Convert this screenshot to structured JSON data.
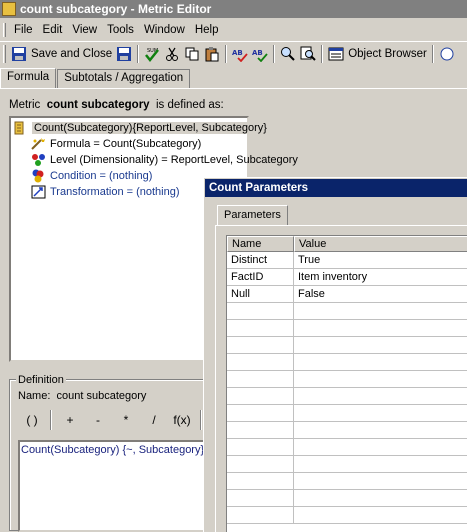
{
  "window": {
    "title": "count subcategory - Metric Editor"
  },
  "menu": [
    "File",
    "Edit",
    "View",
    "Tools",
    "Window",
    "Help"
  ],
  "toolbar": {
    "save_close_label": "Save and Close",
    "object_browser_label": "Object Browser",
    "sum_label": "SUM"
  },
  "tabs": [
    {
      "label": "Formula",
      "active": true
    },
    {
      "label": "Subtotals / Aggregation",
      "active": false
    }
  ],
  "metric_header": {
    "prefix": "Metric",
    "name": "count subcategory",
    "suffix": "is defined as:"
  },
  "tree": {
    "root": "Count(Subcategory){ReportLevel, Subcategory}",
    "formula": "Formula = Count(Subcategory)",
    "level": "Level (Dimensionality) = ReportLevel, Subcategory",
    "condition": "Condition = (nothing)",
    "transformation": "Transformation = (nothing)"
  },
  "definition": {
    "legend": "Definition",
    "name_label": "Name:",
    "name_value": "count subcategory",
    "operators": [
      "( )",
      "+",
      "-",
      "*",
      "/",
      "f(x)"
    ],
    "expression": "Count(Subcategory) {~, Subcategory}"
  },
  "dialog": {
    "title": "Count Parameters",
    "tab": "Parameters",
    "columns": [
      "Name",
      "Value"
    ],
    "rows": [
      {
        "name": "Distinct",
        "value": "True"
      },
      {
        "name": "FactID",
        "value": "Item inventory"
      },
      {
        "name": "Null",
        "value": "False"
      }
    ]
  },
  "colors": {
    "dialog_title_bg": "#0a246a",
    "title_bg_inactive": "#808080",
    "tree_link": "#1a3a8f"
  }
}
